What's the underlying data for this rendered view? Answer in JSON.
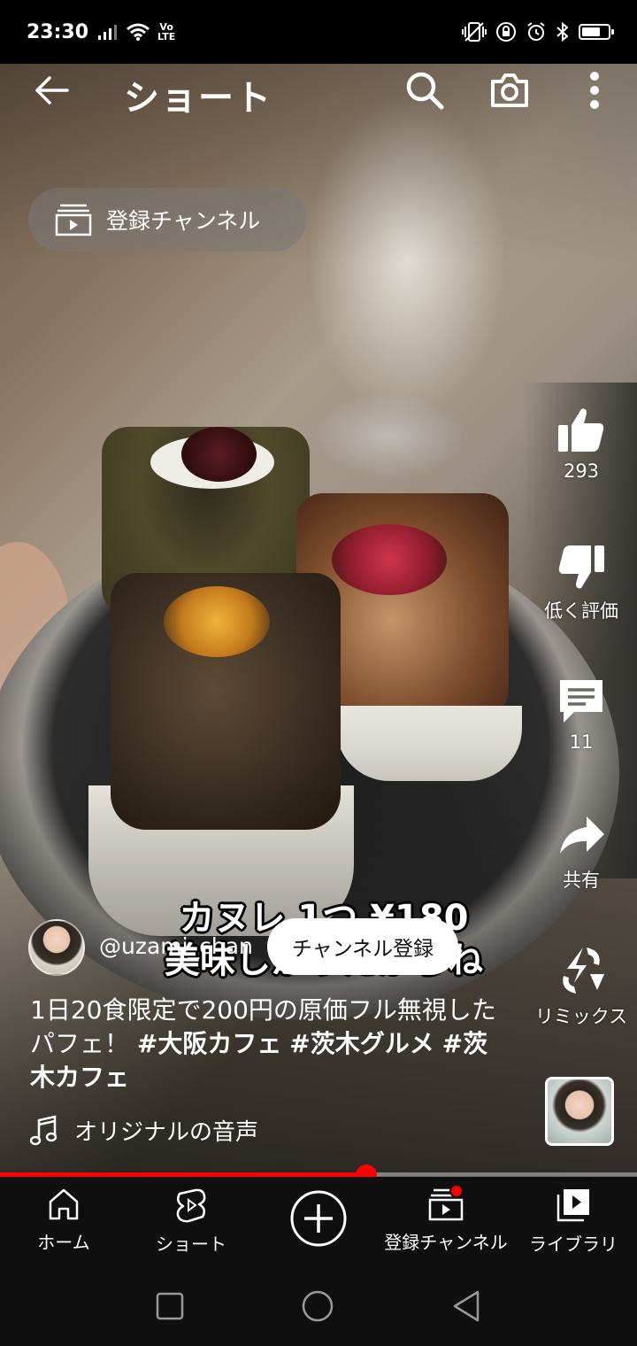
{
  "status_bar": {
    "time": "23:30",
    "volte_top": "Vo",
    "volte_bottom": "LTE",
    "battery_level": 0.75
  },
  "header": {
    "title": "ショート",
    "icons": [
      "back-arrow-icon",
      "search-icon",
      "camera-icon",
      "more-vert-icon"
    ]
  },
  "subscriptions_chip": {
    "label": "登録チャンネル",
    "icon": "subscriptions-icon"
  },
  "video": {
    "caption_line1": "カヌレ 1つ ¥180",
    "caption_line2": "美味しかったからね"
  },
  "actions": {
    "like_count": "293",
    "dislike_label": "低く評価",
    "comment_count": "11",
    "share_label": "共有",
    "remix_label": "リミックス"
  },
  "channel": {
    "handle": "@uzami_chan",
    "subscribe_label": "チャンネル登録"
  },
  "description": {
    "text": "1日20食限定で200円の原価フル無視したパフェ！ ",
    "hashtag1": "#大阪カフェ",
    "hashtag2": "#茨木グルメ",
    "hashtag3": "#茨木カフェ"
  },
  "sound": {
    "label": "オリジナルの音声"
  },
  "progress": {
    "fraction": 0.575
  },
  "bottom_nav": {
    "home": "ホーム",
    "shorts": "ショート",
    "subscriptions": "登録チャンネル",
    "library": "ライブラリ"
  },
  "colors": {
    "accent_red": "#ff0000",
    "nav_background": "#0f0f0f"
  }
}
